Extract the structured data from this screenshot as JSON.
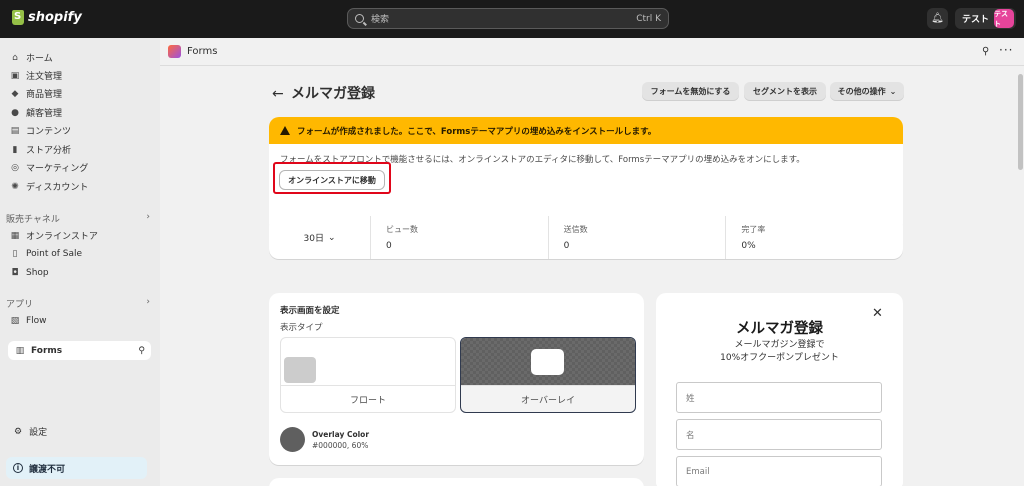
{
  "topbar": {
    "brand": "shopify",
    "search_placeholder": "検索",
    "search_shortcut": "Ctrl K",
    "store_name": "テスト",
    "avatar_text": "テスト"
  },
  "sidebar": {
    "items": [
      {
        "label": "ホーム",
        "icon": "home-icon"
      },
      {
        "label": "注文管理",
        "icon": "orders-icon"
      },
      {
        "label": "商品管理",
        "icon": "tag-icon"
      },
      {
        "label": "顧客管理",
        "icon": "person-icon"
      },
      {
        "label": "コンテンツ",
        "icon": "content-icon"
      },
      {
        "label": "ストア分析",
        "icon": "chart-icon"
      },
      {
        "label": "マーケティング",
        "icon": "target-icon"
      },
      {
        "label": "ディスカウント",
        "icon": "discount-icon"
      }
    ],
    "sales_channels_label": "販売チャネル",
    "channels": [
      {
        "label": "オンラインストア",
        "icon": "store-icon"
      },
      {
        "label": "Point of Sale",
        "icon": "pos-icon"
      },
      {
        "label": "Shop",
        "icon": "shop-icon"
      }
    ],
    "apps_label": "アプリ",
    "apps": [
      {
        "label": "Flow",
        "icon": "flow-icon"
      },
      {
        "label": "Forms",
        "icon": "forms-icon"
      }
    ],
    "settings_label": "設定",
    "trouble_label": "譲渡不可"
  },
  "appbar": {
    "app_name": "Forms"
  },
  "page": {
    "title": "メルマガ登録",
    "actions": [
      "フォームを無効にする",
      "セグメントを表示",
      "その他の操作"
    ]
  },
  "banner": {
    "heading": "フォームが作成されました。ここで、Formsテーマアプリの埋め込みをインストールします。",
    "body": "フォームをストアフロントで機能させるには、オンラインストアのエディタに移動して、Formsテーマアプリの埋め込みをオンにします。",
    "button": "オンラインストアに移動"
  },
  "stats": {
    "period": "30日",
    "cells": [
      {
        "label": "ビュー数",
        "value": "0"
      },
      {
        "label": "送信数",
        "value": "0"
      },
      {
        "label": "完了率",
        "value": "0%"
      }
    ]
  },
  "display": {
    "title": "表示画面を設定",
    "type_label": "表示タイプ",
    "options": [
      "フロート",
      "オーバーレイ"
    ],
    "selected": "オーバーレイ",
    "overlay_color_label": "Overlay Color",
    "overlay_color_value": "#000000, 60%"
  },
  "preview": {
    "title": "メルマガ登録",
    "subtitle_line1": "メールマガジン登録で",
    "subtitle_line2": "10%オフクーポンプレゼント",
    "fields": [
      "姓",
      "名",
      "Email"
    ]
  },
  "colors": {
    "banner": "#ffb800",
    "highlight": "#e0061a",
    "avatar": "#e6449b"
  }
}
